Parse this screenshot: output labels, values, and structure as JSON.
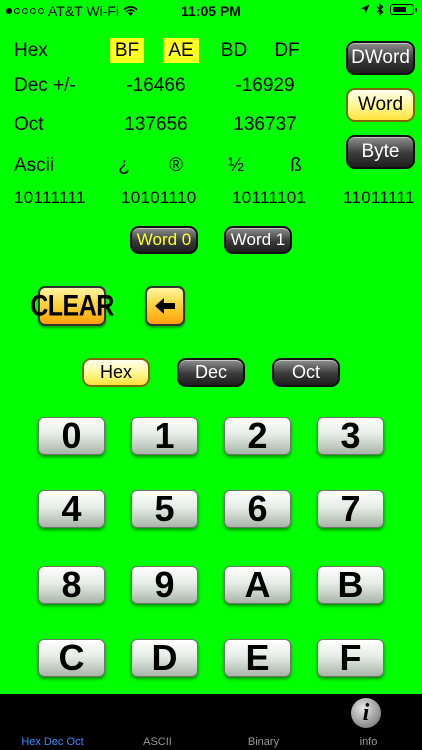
{
  "status": {
    "carrier": "AT&T Wi-Fi",
    "time": "11:05 PM",
    "signal_dots_filled": 1,
    "signal_dots_total": 5
  },
  "rows": {
    "hex": {
      "label": "Hex",
      "values": [
        "BF",
        "AE",
        "BD",
        "DF"
      ],
      "highlighted": [
        true,
        true,
        false,
        false
      ]
    },
    "dec": {
      "label": "Dec +/-",
      "values": [
        "-16466",
        "-16929"
      ]
    },
    "oct": {
      "label": "Oct",
      "values": [
        "137656",
        "136737"
      ]
    },
    "ascii": {
      "label": "Ascii",
      "values": [
        "¿",
        "®",
        "½",
        "ß"
      ]
    },
    "binary": [
      "10111111",
      "10101110",
      "10111101",
      "11011111"
    ]
  },
  "size_buttons": {
    "dword": "DWord",
    "word": "Word",
    "byte": "Byte",
    "selected": "word"
  },
  "word_buttons": {
    "word0": "Word 0",
    "word1": "Word 1"
  },
  "clear_label": "CLEAR",
  "base_buttons": {
    "hex": "Hex",
    "dec": "Dec",
    "oct": "Oct",
    "selected": "hex"
  },
  "keypad": [
    "0",
    "1",
    "2",
    "3",
    "4",
    "5",
    "6",
    "7",
    "8",
    "9",
    "A",
    "B",
    "C",
    "D",
    "E",
    "F"
  ],
  "tabs": [
    {
      "label": "Hex Dec Oct",
      "active": true
    },
    {
      "label": "ASCII",
      "active": false
    },
    {
      "label": "Binary",
      "active": false
    },
    {
      "label": "info",
      "active": false
    }
  ],
  "colors": {
    "background": "#00ff00",
    "highlight": "#ffff22",
    "active_tab": "#3a8bff"
  }
}
